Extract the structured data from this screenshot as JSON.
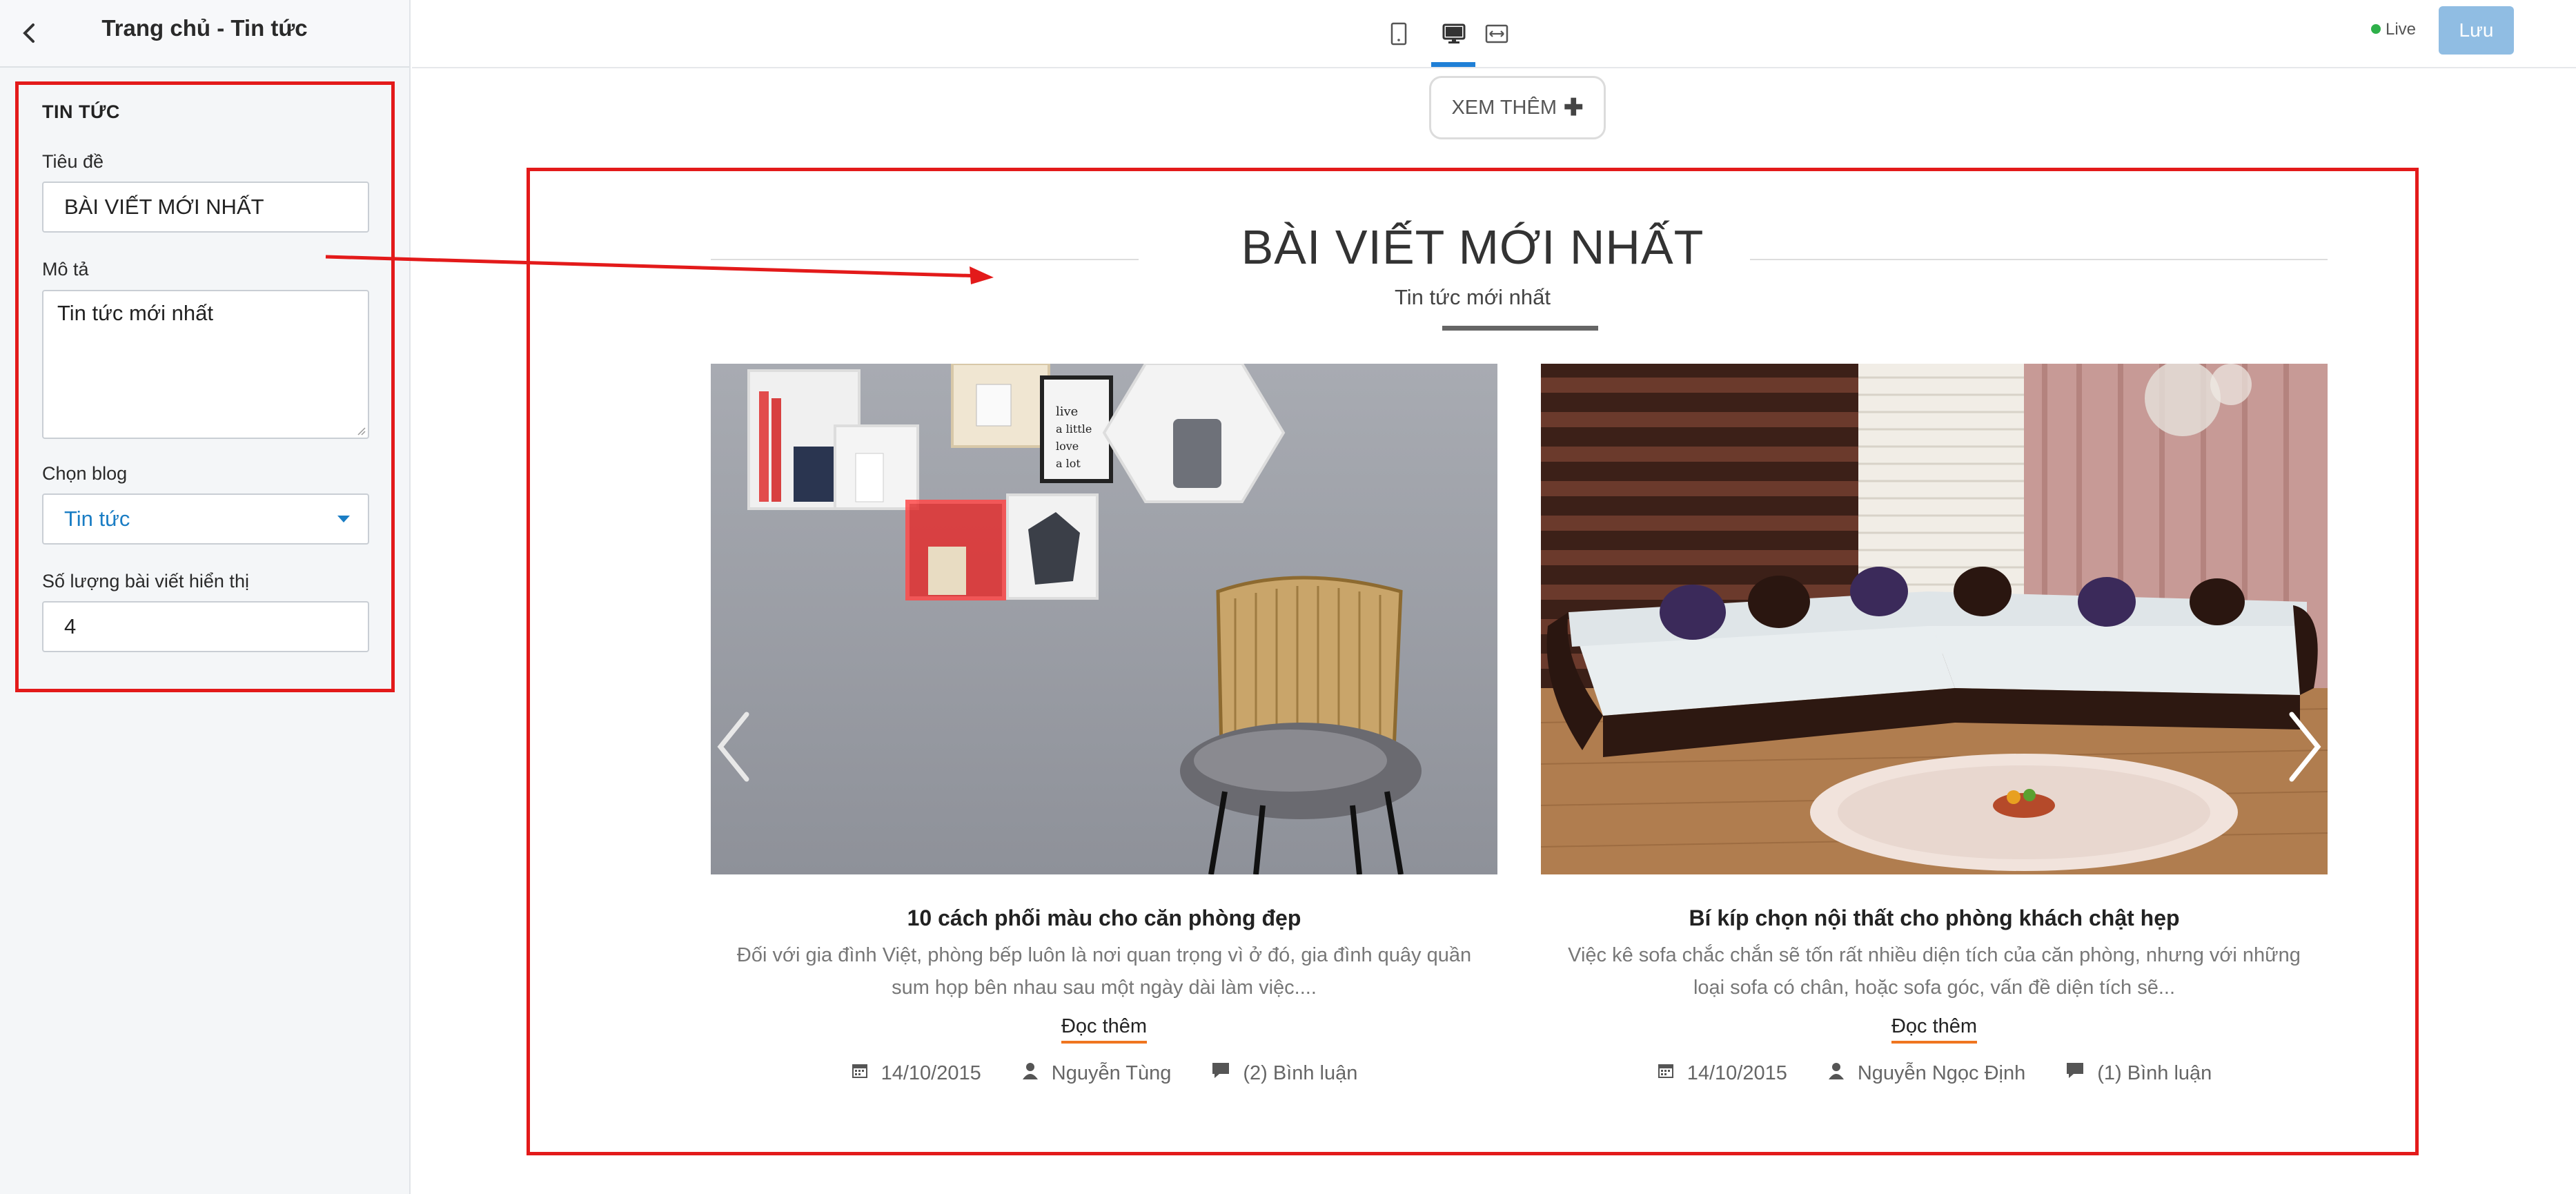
{
  "sidebar": {
    "title": "Trang chủ - Tin tức",
    "section_title": "TIN TỨC",
    "fields": {
      "title_label": "Tiêu đề",
      "title_value": "BÀI VIẾT MỚI NHẤT",
      "desc_label": "Mô tả",
      "desc_value": "Tin tức mới nhất",
      "blog_label": "Chọn blog",
      "blog_value": "Tin tức",
      "count_label": "Số lượng bài viết hiển thị",
      "count_value": "4"
    }
  },
  "topbar": {
    "live_label": "Live",
    "save_label": "Lưu"
  },
  "canvas": {
    "more_button": "XEM THÊM",
    "blog_title": "BÀI VIẾT MỚI NHẤT",
    "blog_subtitle": "Tin tức mới nhất",
    "read_more": "Đọc thêm",
    "posts": [
      {
        "title": "10 cách phối màu cho căn phòng đẹp",
        "excerpt": "Đối với gia đình Việt, phòng bếp luôn là nơi quan trọng vì ở đó, gia đình quây quần sum họp bên nhau sau một ngày dài làm việc....",
        "date": "14/10/2015",
        "author": "Nguyễn Tùng",
        "comments": "(2) Bình luận"
      },
      {
        "title": "Bí kíp chọn nội thất cho phòng khách chật hẹp",
        "excerpt": "Việc kê sofa chắc chắn sẽ tốn rất nhiều diện tích của căn phòng, nhưng với những loại sofa có chân, hoặc sofa góc, vấn đề diện tích sẽ...",
        "date": "14/10/2015",
        "author": "Nguyễn Ngọc Định",
        "comments": "(1) Bình luận"
      }
    ]
  },
  "colors": {
    "highlight_red": "#e31a1a",
    "accent_blue": "#1f7fd6",
    "live_green": "#2eb04a",
    "save_button": "#90bde3",
    "read_more_underline": "#f07620"
  }
}
